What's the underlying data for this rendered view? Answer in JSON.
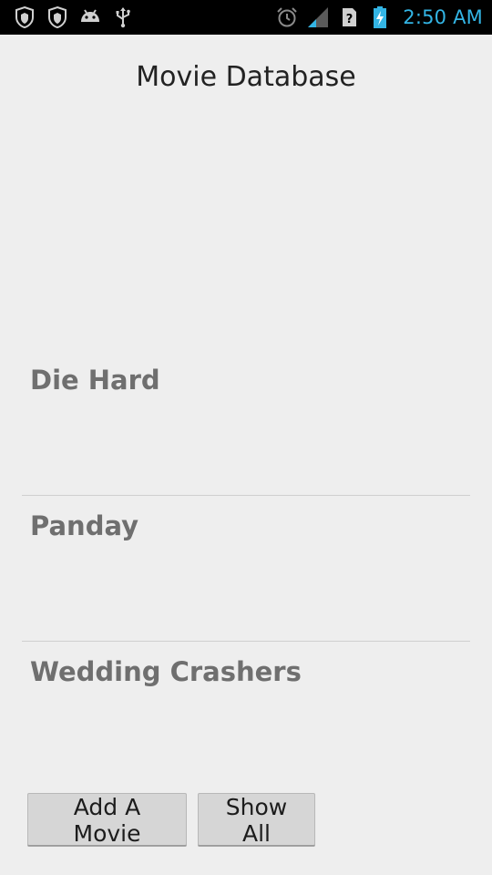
{
  "status_bar": {
    "time": "2:50 AM",
    "left_icons": [
      "shield-icon",
      "shield-icon",
      "android-icon",
      "usb-icon"
    ],
    "right_icons": [
      "alarm-icon",
      "signal-icon",
      "unknown-sim-icon",
      "battery-charging-icon"
    ],
    "accent_color": "#33b5e5"
  },
  "app": {
    "title": "Movie Database"
  },
  "movies": [
    {
      "title": "Die Hard"
    },
    {
      "title": "Panday"
    },
    {
      "title": "Wedding Crashers"
    }
  ],
  "buttons": {
    "add_label": "Add A Movie",
    "show_all_label": "Show All"
  }
}
